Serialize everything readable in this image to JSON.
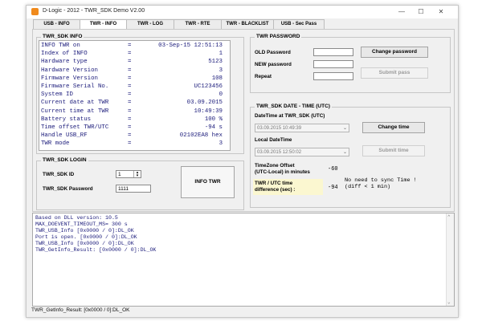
{
  "window": {
    "title": "D-Logic - 2012 - TWR_SDK Demo V2.00",
    "minimize": "—",
    "maximize": "☐",
    "close": "✕"
  },
  "tabs": [
    "USB - INFO",
    "TWR - INFO",
    "TWR - LOG",
    "TWR - RTE",
    "TWR - BLACKLIST",
    "USB - Sec Pass"
  ],
  "info_group": {
    "title": "TWR_SDK INFO",
    "rows": [
      {
        "key": "INFO TWR on",
        "val": "03-Sep-15 12:51:13"
      },
      {
        "key": "Index of INFO",
        "val": "1"
      },
      {
        "key": "Hardware type",
        "val": "5123"
      },
      {
        "key": "Hardware Version",
        "val": "3"
      },
      {
        "key": "Firmware Version",
        "val": "108"
      },
      {
        "key": "Firmware Serial No.",
        "val": "UC123456"
      },
      {
        "key": "System ID",
        "val": "0"
      },
      {
        "key": "Current date at TWR",
        "val": "03.09.2015"
      },
      {
        "key": "Current time at TWR",
        "val": "10:49:39"
      },
      {
        "key": "Battery status",
        "val": "100 %"
      },
      {
        "key": "Time offset TWR/UTC",
        "val": "-94 s"
      },
      {
        "key": "Handle USB_RF",
        "val": "02102EA8 hex"
      },
      {
        "key": "TWR mode",
        "val": "3"
      }
    ]
  },
  "login_group": {
    "title": "TWR_SDK LOGIN",
    "id_label": "TWR_SDK ID",
    "id_value": "1",
    "password_label": "TWR_SDK Password",
    "password_value": "1111",
    "info_button": "INFO TWR"
  },
  "password_group": {
    "title": "TWR PASSWORD",
    "old_label": "OLD Password",
    "new_label": "NEW password",
    "repeat_label": "Repeat",
    "change_button": "Change password",
    "submit_button": "Submit pass"
  },
  "datetime_group": {
    "title": "TWR_SDK DATE - TIME (UTC)",
    "twr_label": "DateTime at TWR_SDK (UTC)",
    "twr_value": "03.09.2015 10:49:39",
    "change_button": "Change time",
    "local_label": "Local DateTime",
    "local_value": "03.09.2015 12:50:02",
    "submit_button": "Submit time",
    "tz_label_1": "TimeZone Offset",
    "tz_label_2": "(UTC-Local) in minutes",
    "tz_value": "-60",
    "diff_label_1": "TWR / UTC time",
    "diff_label_2": "difference (sec) :",
    "diff_value": "-94",
    "sync_msg_1": "No need to sync Time !",
    "sync_msg_2": "(diff < 1 min)"
  },
  "log": [
    "Based on DLL version: 10.5",
    "MAX_DOEVENT_TIMEOUT_MS= 300 s",
    "TWR_USB_Info [0x0000 / 0]:DL_OK",
    "Port is open. [0x0000 / 0]:DL_OK",
    "TWR_USB_Info [0x0000 / 0]:DL_OK",
    "TWR_GetInfo_Result: [0x0000 / 0]:DL_OK"
  ],
  "status_bar": "TWR_GetInfo_Result: [0x0000 / 0]:DL_OK"
}
